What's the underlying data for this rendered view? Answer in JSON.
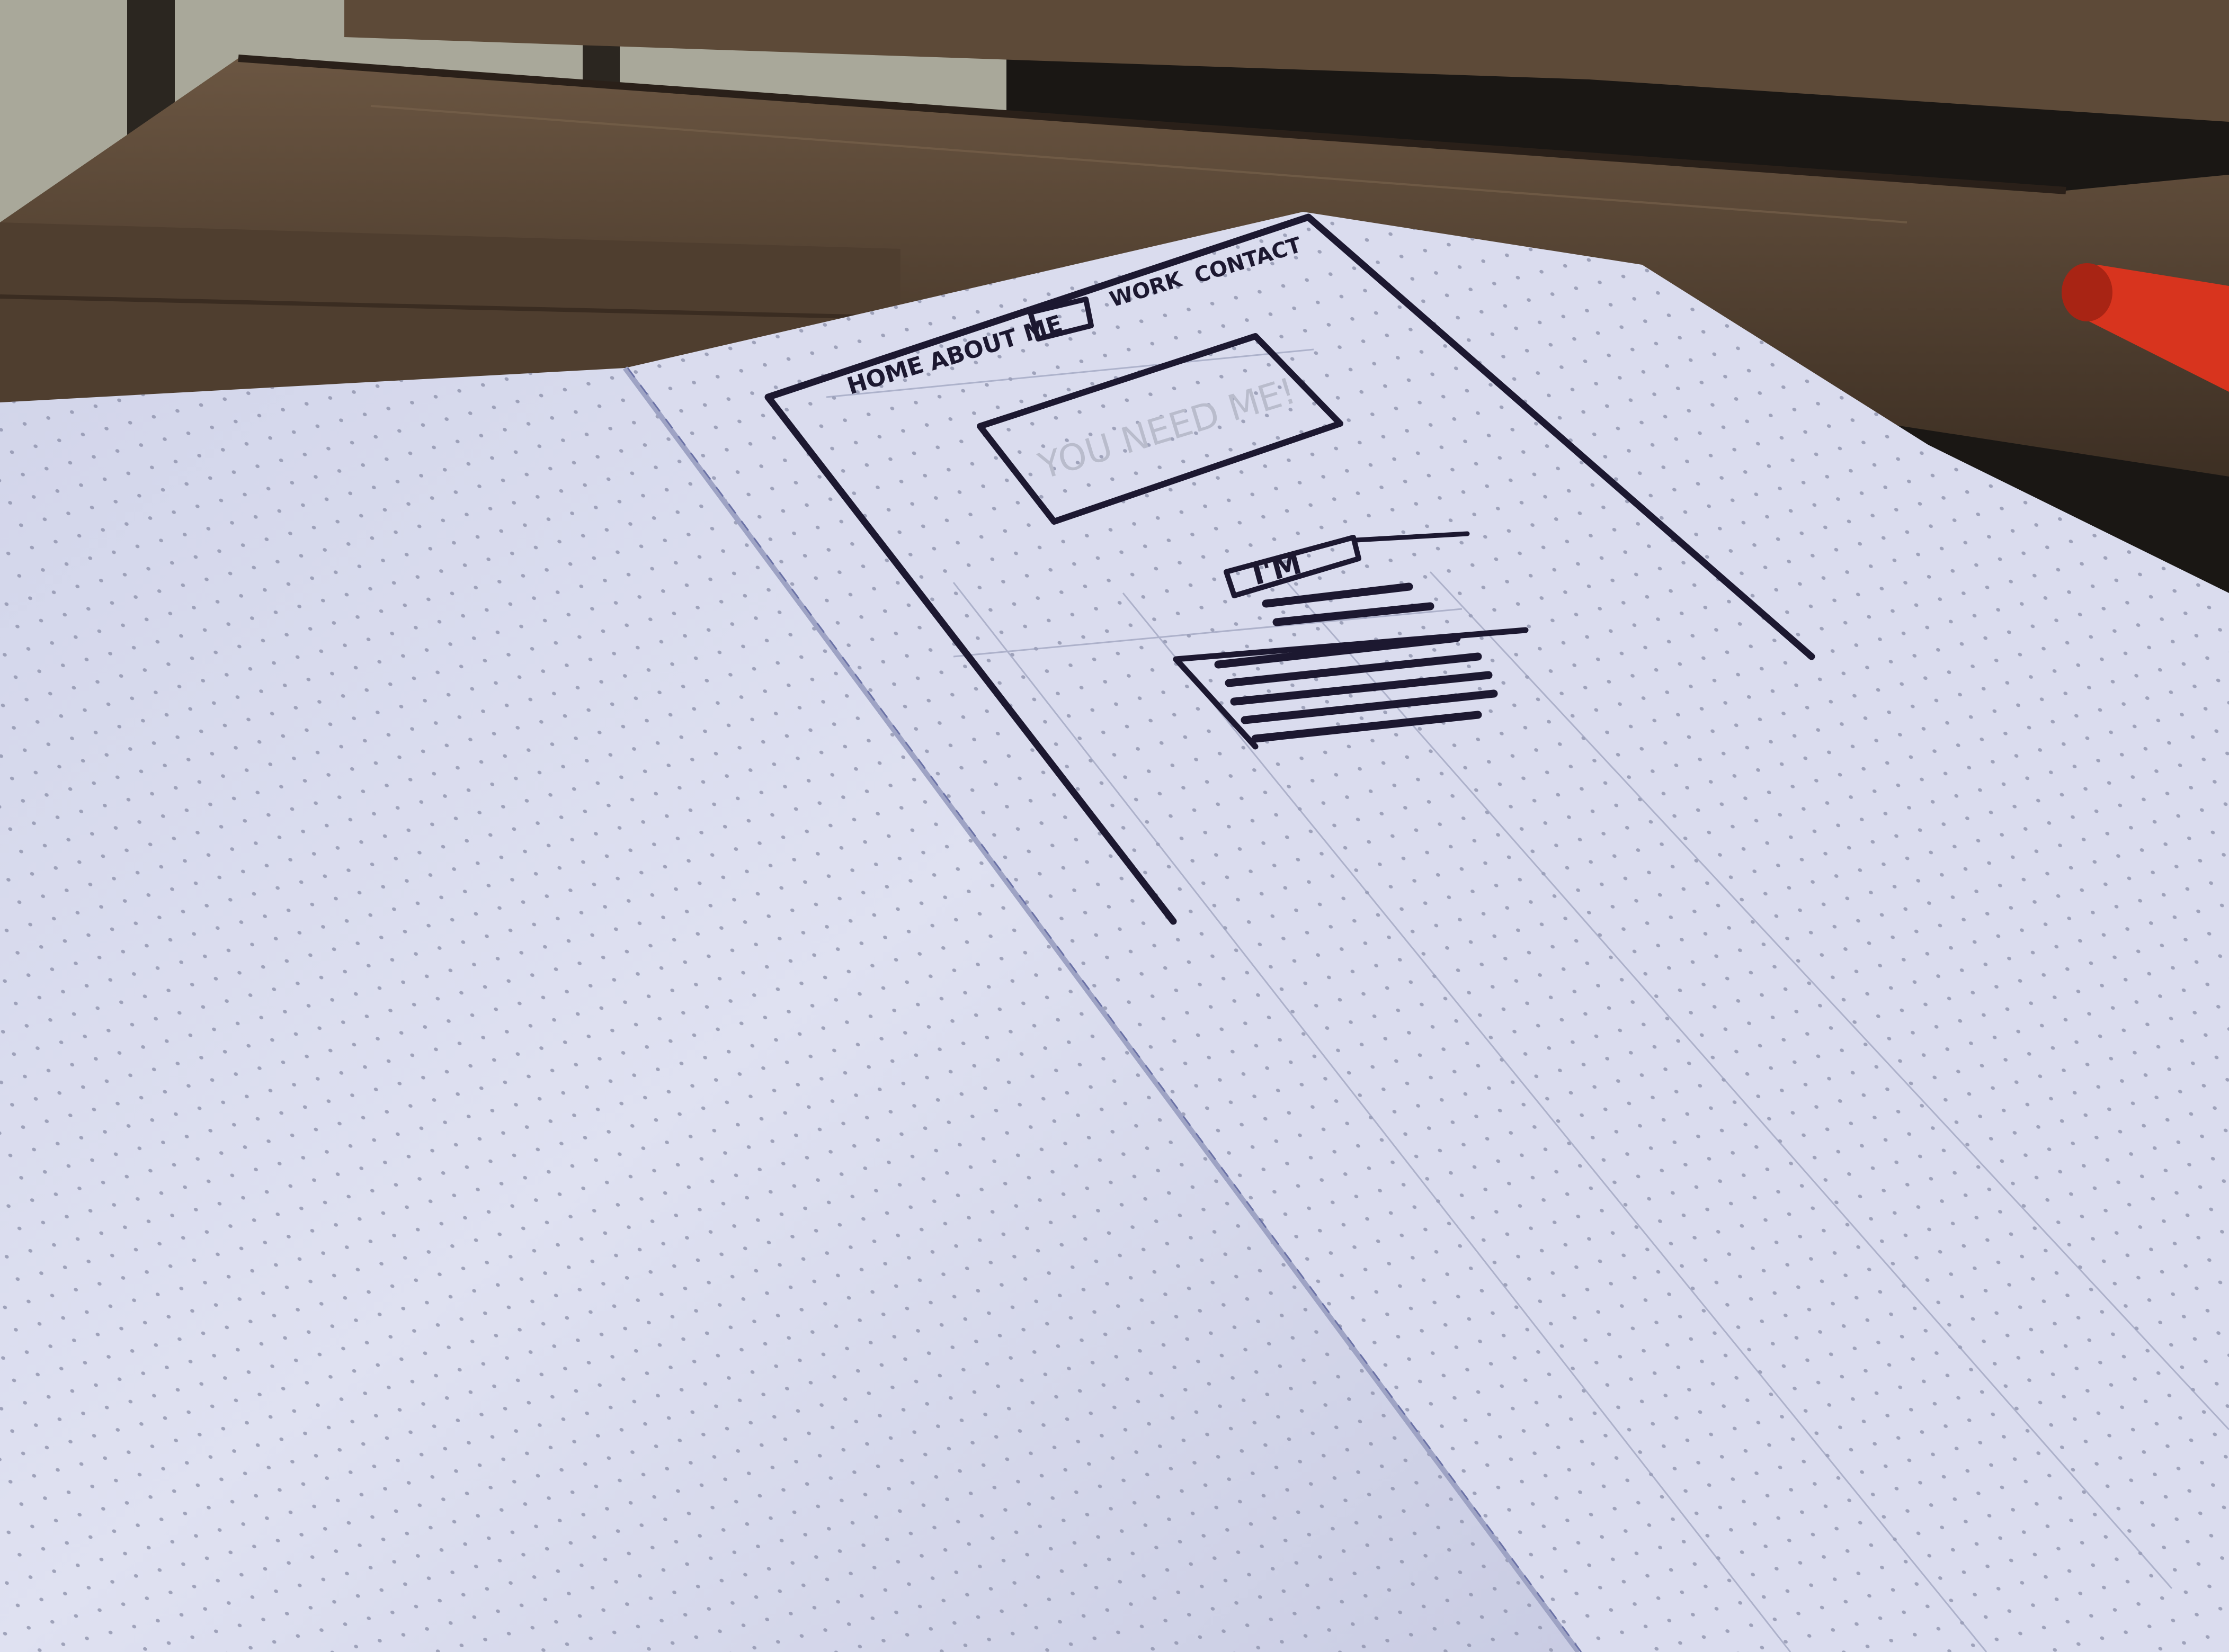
{
  "photo": {
    "subject": "hand-drawn website wireframe on dotted notebook paper",
    "colors": {
      "paper": "#dcdff0",
      "paper_shadow": "#c4c8df",
      "dots": "#8a8ea8",
      "ink": "#1c1830",
      "pencil": "#9aa0bc",
      "table_wood": "#4a3a2c",
      "wood_light": "#6b5642",
      "background": "#1a1714",
      "marker": "#d8341e"
    }
  },
  "wireframe": {
    "nav_home": "HOME",
    "nav_about": "ABOUT ME",
    "nav_work": "WORK",
    "nav_contact": "CONTACT",
    "hero_text": "YOU NEED ME!",
    "heading_text": "I'M"
  }
}
